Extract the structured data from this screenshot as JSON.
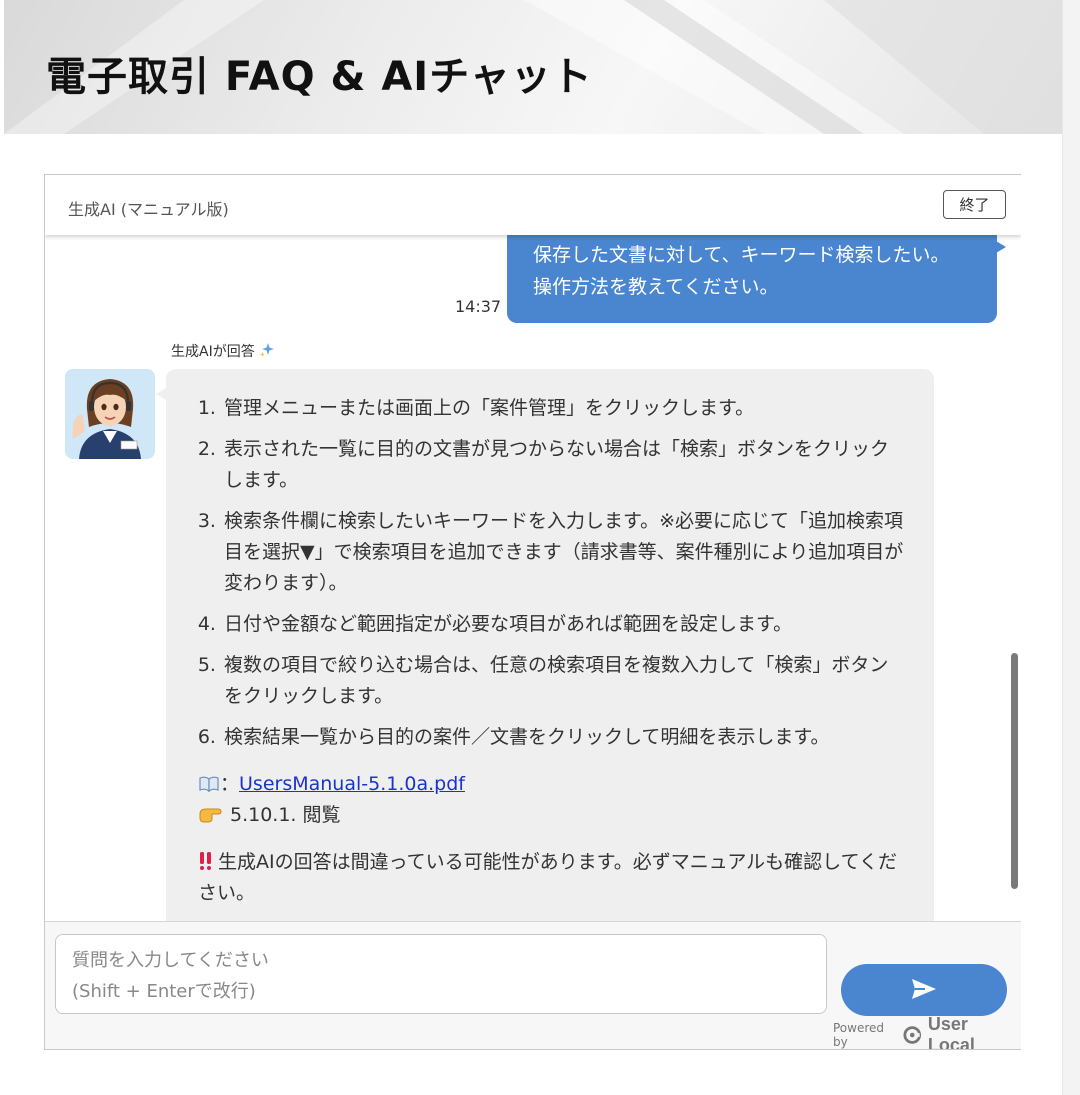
{
  "page": {
    "title": "電子取引 FAQ & AIチャット"
  },
  "chat": {
    "header_title": "生成AI (マニュアル版)",
    "end_label": "終了",
    "user_message": {
      "lines": [
        "保存した文書に対して、キーワード検索したい。",
        "操作方法を教えてください。"
      ],
      "time": "14:37"
    },
    "ai_label": "生成AIが回答",
    "ai_message": {
      "steps": [
        {
          "num": "1.",
          "text": "管理メニューまたは画面上の「案件管理」をクリックします。"
        },
        {
          "num": "2.",
          "text": "表示された一覧に目的の文書が見つからない場合は「検索」ボタンをクリックします。"
        },
        {
          "num": "3.",
          "text": "検索条件欄に検索したいキーワードを入力します。※必要に応じて「追加検索項目を選択▼」で検索項目を追加できます（請求書等、案件種別により追加項目が変わります）。"
        },
        {
          "num": "4.",
          "text": "日付や金額など範囲指定が必要な項目があれば範囲を設定します。"
        },
        {
          "num": "5.",
          "text": "複数の項目で絞り込む場合は、任意の検索項目を複数入力して「検索」ボタンをクリックします。"
        },
        {
          "num": "6.",
          "text": "検索結果一覧から目的の案件／文書をクリックして明細を表示します。"
        }
      ],
      "manual_sep": "：",
      "manual_link": "UsersManual-5.1.0a.pdf",
      "manual_section": "5.10.1. 閲覧",
      "warning": "生成AIの回答は間違っている可能性があります。必ずマニュアルも確認してください。"
    },
    "input": {
      "placeholder": "質問を入力してください\n(Shift + Enterで改行)"
    },
    "powered_by": "Powered by",
    "brand": "User Local"
  },
  "icons": {
    "sparkle": "sparkle-icon",
    "book": "book-icon",
    "pointing_hand": "pointing-hand-icon",
    "warning": "double-exclamation-icon",
    "send": "send-icon",
    "brand_logo": "user-local-logo-icon"
  },
  "colors": {
    "accent": "#4a86cf",
    "ai_bubble": "#efefef",
    "link": "#1a33cc",
    "warning": "#e0204a",
    "sparkle": "#5aa0e8"
  }
}
